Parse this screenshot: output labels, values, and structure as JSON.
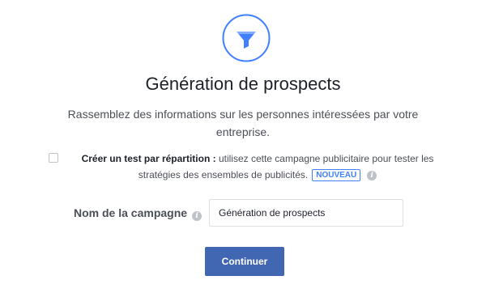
{
  "hero": {
    "icon": "funnel-icon",
    "accent_color": "#4080ff"
  },
  "title": "Génération de prospects",
  "subtitle": "Rassemblez des informations sur les personnes intéressées par votre entreprise.",
  "split_test": {
    "checked": false,
    "label_bold": "Créer un test par répartition :",
    "label_text": " utilisez cette campagne publicitaire pour tester les stratégies des ensembles de publicités.",
    "badge": "NOUVEAU",
    "info_icon": "info-icon"
  },
  "campaign": {
    "label": "Nom de la campagne",
    "info_icon": "info-icon",
    "value": "Génération de prospects"
  },
  "continue_button": {
    "label": "Continuer",
    "color": "#4267b2"
  }
}
